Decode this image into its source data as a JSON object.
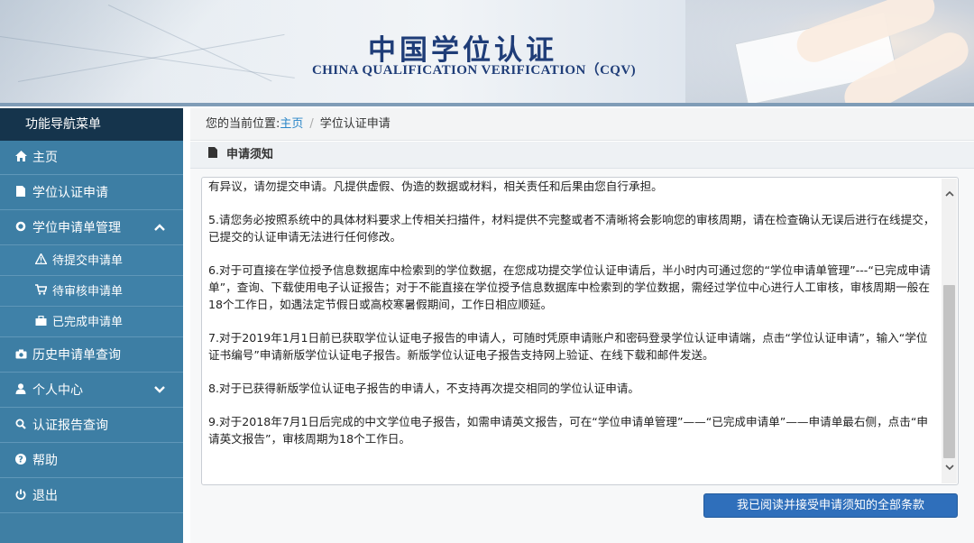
{
  "banner": {
    "title": "中国学位认证",
    "subtitle": "CHINA QUALIFICATION VERIFICATION（CQV)"
  },
  "sidebar": {
    "header": "功能导航菜单",
    "items": [
      {
        "label": "主页",
        "icon": "home-icon"
      },
      {
        "label": "学位认证申请",
        "icon": "document-icon"
      },
      {
        "label": "学位申请单管理",
        "icon": "gear-icon",
        "expanded": true
      },
      {
        "label": "待提交申请单",
        "icon": "warning-icon"
      },
      {
        "label": "待审核申请单",
        "icon": "cart-icon"
      },
      {
        "label": "已完成申请单",
        "icon": "briefcase-icon"
      },
      {
        "label": "历史申请单查询",
        "icon": "camera-icon"
      },
      {
        "label": "个人中心",
        "icon": "user-icon",
        "expanded": false
      },
      {
        "label": "认证报告查询",
        "icon": "search-icon"
      },
      {
        "label": "帮助",
        "icon": "question-icon"
      },
      {
        "label": "退出",
        "icon": "power-icon"
      }
    ]
  },
  "breadcrumb": {
    "prefix": "您的当前位置:",
    "home": "主页",
    "separator": "/",
    "current": "学位认证申请"
  },
  "panel": {
    "title": "申请须知"
  },
  "notice": {
    "paragraphs": [
      "有异议，请勿提交申请。凡提供虚假、伪造的数据或材料，相关责任和后果由您自行承担。",
      "5.请您务必按照系统中的具体材料要求上传相关扫描件，材料提供不完整或者不清晰将会影响您的审核周期，请在检查确认无误后进行在线提交，已提交的认证申请无法进行任何修改。",
      "6.对于可直接在学位授予信息数据库中检索到的学位数据，在您成功提交学位认证申请后，半小时内可通过您的“学位申请单管理”---“已完成申请单”，查询、下载使用电子认证报告；对于不能直接在学位授予信息数据库中检索到的学位数据，需经过学位中心进行人工审核，审核周期一般在18个工作日，如遇法定节假日或高校寒暑假期间，工作日相应顺延。",
      "7.对于2019年1月1日前已获取学位认证电子报告的申请人，可随时凭原申请账户和密码登录学位认证申请端，点击“学位认证申请”，输入“学位证书编号”申请新版学位认证电子报告。新版学位认证电子报告支持网上验证、在线下载和邮件发送。",
      "8.对于已获得新版学位认证电子报告的申请人，不支持再次提交相同的学位认证申请。",
      "9.对于2018年7月1日后完成的中文学位电子报告，如需申请英文报告，可在“学位申请单管理”——“已完成申请单”——申请单最右侧，点击“申请英文报告”，审核周期为18个工作日。"
    ]
  },
  "accept_button": "我已阅读并接受申请须知的全部条款",
  "colors": {
    "sidebar_bg": "#3f7fa4",
    "sidebar_header": "#15344c",
    "title_blue": "#1f3d78",
    "link_blue": "#2a86c8",
    "button_blue": "#2f6fbb"
  }
}
